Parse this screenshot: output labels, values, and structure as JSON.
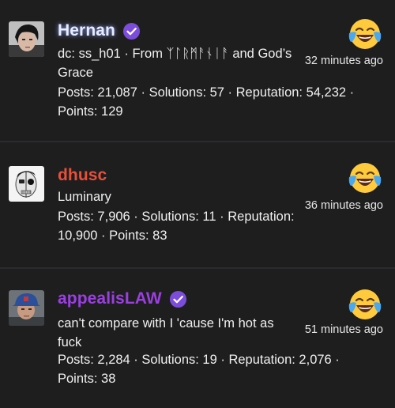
{
  "posts": [
    {
      "username": "Hernan",
      "username_color": "#e9ecff",
      "verified": true,
      "title": "dc: ss_h01 · From ᛉᛚᚱᛗᚨᚾᛁᚨ and God’s Grace",
      "stats": "Posts: 21,087 · Solutions: 57 · Reputation: 54,232 · Points: 129",
      "time": "32 minutes ago",
      "reaction": "face-with-tears-of-joy-icon"
    },
    {
      "username": "dhusc",
      "username_color": "#e8503a",
      "verified": false,
      "title": "Luminary",
      "stats": "Posts: 7,906 · Solutions: 11 · Reputation: 10,900 · Points: 83",
      "time": "36 minutes ago",
      "reaction": "face-with-tears-of-joy-icon"
    },
    {
      "username": "appealisLAW",
      "username_color": "#9b3fe0",
      "verified": true,
      "title": "can't compare with I 'cause I'm hot as fuck",
      "stats": "Posts: 2,284 · Solutions: 19 · Reputation: 2,076 · Points: 38",
      "time": "51 minutes ago",
      "reaction": "face-with-tears-of-joy-icon"
    }
  ],
  "colors": {
    "background": "#1e1e1f",
    "divider": "#2b2b2d",
    "verified_badge": "#7c4ddb",
    "text": "#f0f0f0"
  }
}
